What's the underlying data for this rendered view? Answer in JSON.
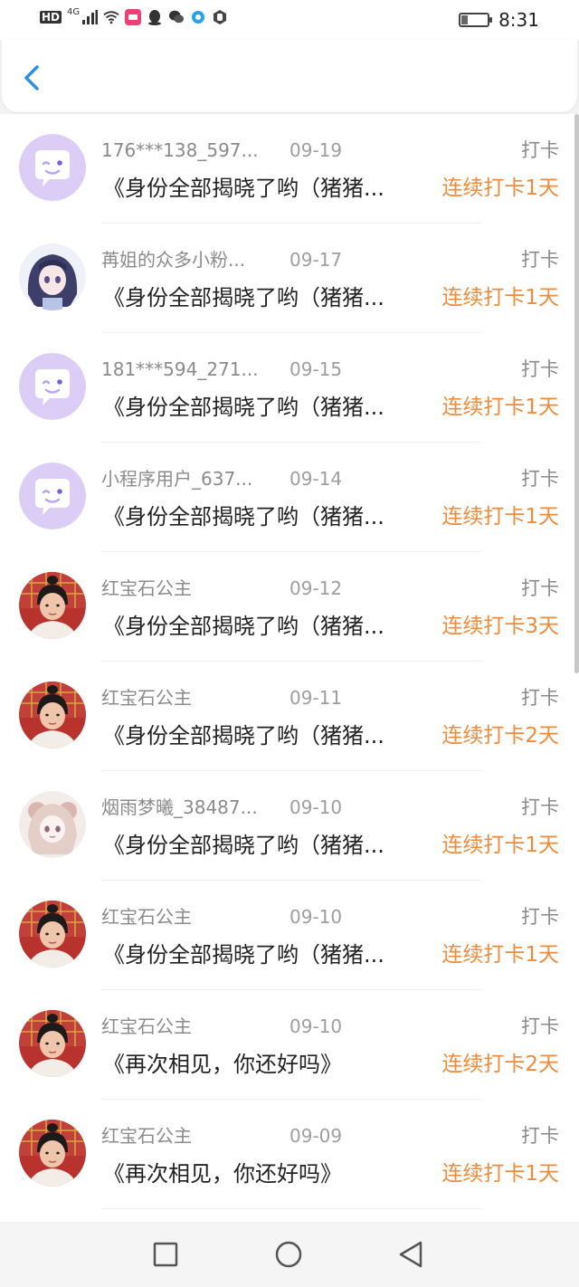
{
  "status_bar": {
    "hd": "HD",
    "network": "4G",
    "time": "8:31",
    "battery_level": 0.25
  },
  "header": {
    "back_icon": "chevron-left-icon"
  },
  "colors": {
    "accent": "#ef8b3a",
    "back_blue": "#2f8fe6",
    "default_avatar": "#dccdf6"
  },
  "rows": [
    {
      "avatar": "default",
      "nickname": "176***138_597...",
      "date": "09-19",
      "tag": "打卡",
      "title": "《身份全部揭晓了哟（猪猪...",
      "streak": "连续打卡1天"
    },
    {
      "avatar": "anime-girl",
      "nickname": "苒姐的众多小粉...",
      "date": "09-17",
      "tag": "打卡",
      "title": "《身份全部揭晓了哟（猪猪...",
      "streak": "连续打卡1天"
    },
    {
      "avatar": "default",
      "nickname": "181***594_271...",
      "date": "09-15",
      "tag": "打卡",
      "title": "《身份全部揭晓了哟（猪猪...",
      "streak": "连续打卡1天"
    },
    {
      "avatar": "default",
      "nickname": "小程序用户_637...",
      "date": "09-14",
      "tag": "打卡",
      "title": "《身份全部揭晓了哟（猪猪...",
      "streak": "连续打卡1天"
    },
    {
      "avatar": "photo",
      "nickname": "红宝石公主",
      "date": "09-12",
      "tag": "打卡",
      "title": "《身份全部揭晓了哟（猪猪...",
      "streak": "连续打卡3天"
    },
    {
      "avatar": "photo",
      "nickname": "红宝石公主",
      "date": "09-11",
      "tag": "打卡",
      "title": "《身份全部揭晓了哟（猪猪...",
      "streak": "连续打卡2天"
    },
    {
      "avatar": "doll",
      "nickname": "烟雨梦曦_38487...",
      "date": "09-10",
      "tag": "打卡",
      "title": "《身份全部揭晓了哟（猪猪...",
      "streak": "连续打卡1天"
    },
    {
      "avatar": "photo",
      "nickname": "红宝石公主",
      "date": "09-10",
      "tag": "打卡",
      "title": "《身份全部揭晓了哟（猪猪...",
      "streak": "连续打卡1天"
    },
    {
      "avatar": "photo",
      "nickname": "红宝石公主",
      "date": "09-10",
      "tag": "打卡",
      "title": "《再次相见，你还好吗》",
      "streak": "连续打卡2天"
    },
    {
      "avatar": "photo",
      "nickname": "红宝石公主",
      "date": "09-09",
      "tag": "打卡",
      "title": "《再次相见，你还好吗》",
      "streak": "连续打卡1天"
    }
  ],
  "navbar": {
    "recent_icon": "square-icon",
    "home_icon": "circle-icon",
    "back_icon": "triangle-back-icon"
  }
}
